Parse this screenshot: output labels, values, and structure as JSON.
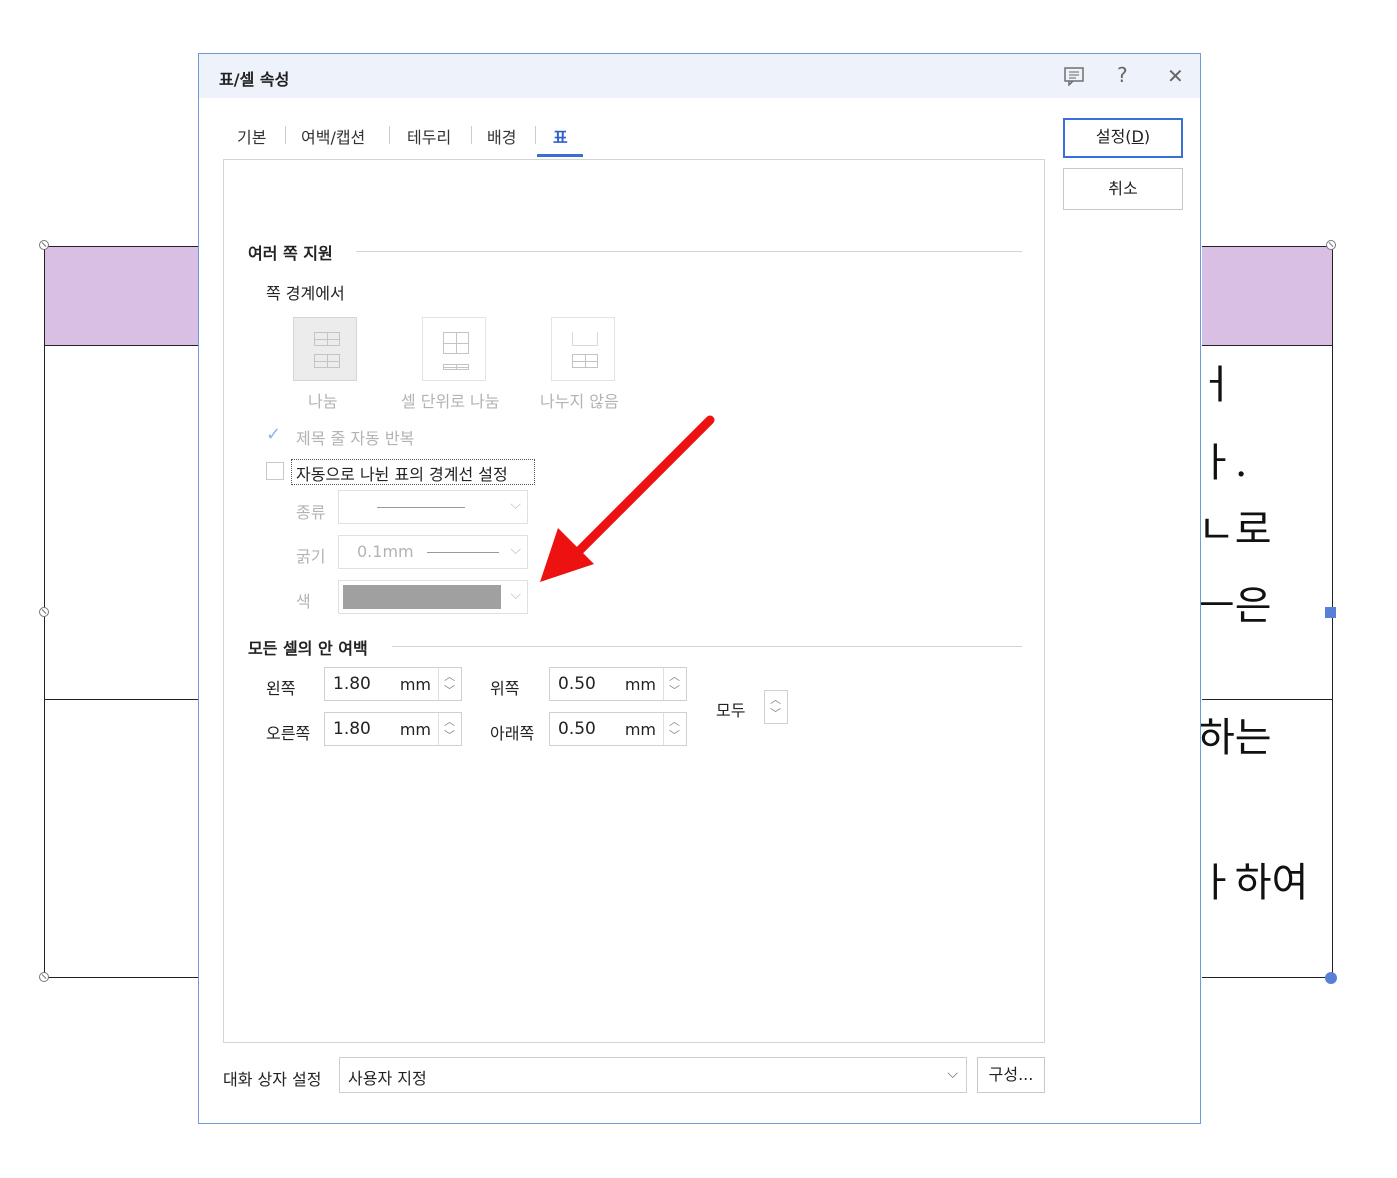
{
  "background_doc": {
    "text_lines": [
      "ㅓ",
      "ㅏ.",
      "ㄴ로",
      "ㅡ은",
      "하는",
      "ㅏ하여"
    ],
    "header_color": "#d8bfe3"
  },
  "dialog": {
    "title": "표/셀 속성",
    "title_icons": {
      "memo": "memo-icon",
      "help": "?",
      "close": "✕"
    },
    "tabs": [
      {
        "label": "기본"
      },
      {
        "label": "여백/캡션"
      },
      {
        "label": "테두리"
      },
      {
        "label": "배경"
      },
      {
        "label": "표"
      }
    ],
    "active_tab": "표",
    "buttons": {
      "ok": "설정(D)",
      "ok_text": "설정(",
      "ok_key": "D",
      "ok_close": ")",
      "cancel": "취소"
    },
    "multi_page": {
      "section_title": "여러 쪽 지원",
      "boundary_label": "쪽 경계에서",
      "split_options": [
        {
          "label": "나눔",
          "selected": true
        },
        {
          "label": "셀 단위로 나눔",
          "selected": false
        },
        {
          "label": "나누지 않음",
          "selected": false
        }
      ],
      "repeat_header": {
        "label": "제목 줄 자동 반복",
        "checked": true,
        "enabled": false
      },
      "auto_border": {
        "label": "자동으로 나뉜 표의 경계선 설정",
        "checked": false
      },
      "type_label": "종류",
      "thickness_label": "굵기",
      "thickness_value": "0.1mm",
      "color_label": "색",
      "color_value": "#a0a0a0"
    },
    "cell_margin": {
      "section_title": "모든 셀의 안 여백",
      "left": {
        "label": "왼쪽",
        "value": "1.80",
        "unit": "mm"
      },
      "right": {
        "label": "오른쪽",
        "value": "1.80",
        "unit": "mm"
      },
      "top": {
        "label": "위쪽",
        "value": "0.50",
        "unit": "mm"
      },
      "bottom": {
        "label": "아래쪽",
        "value": "0.50",
        "unit": "mm"
      },
      "all_label": "모두"
    },
    "footer": {
      "label": "대화 상자 설정",
      "preset_value": "사용자 지정",
      "config_button": "구성..."
    }
  },
  "annotation": {
    "arrow_color": "#ee1111"
  }
}
